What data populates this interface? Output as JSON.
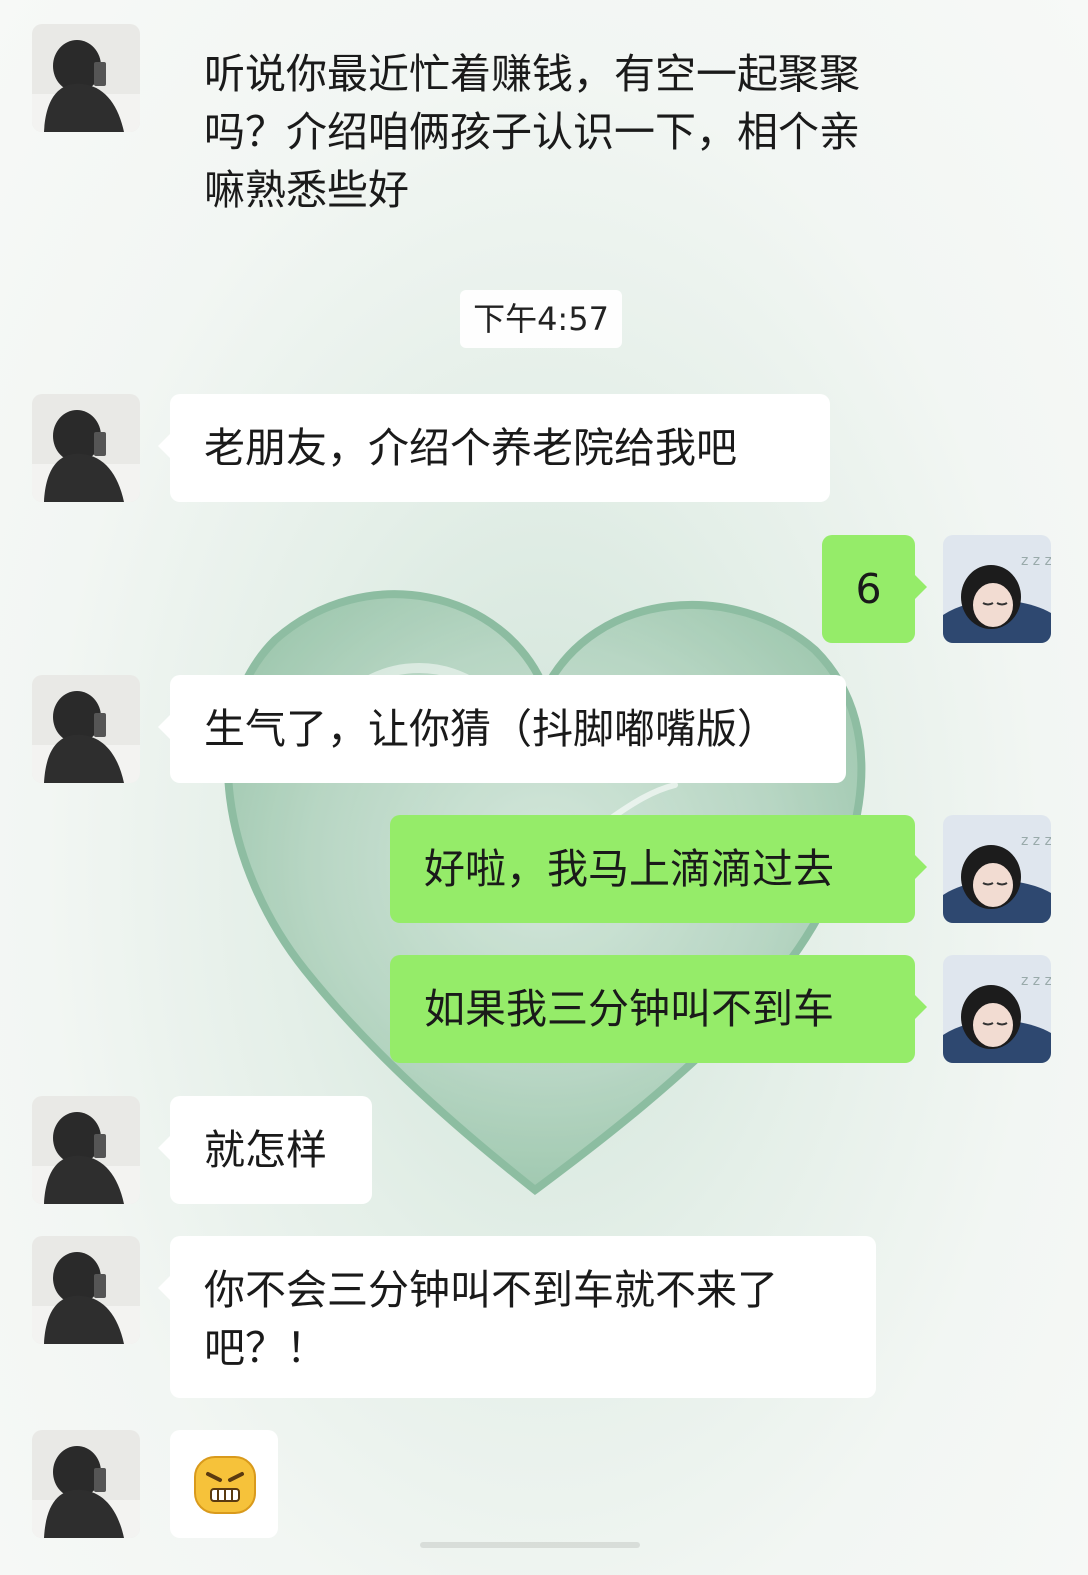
{
  "timestamp": "下午4:57",
  "messages": [
    {
      "side": "in",
      "text": "听说你最近忙着赚钱，有空一起聚聚吗？介绍咱俩孩子认识一下，相个亲嘛熟悉些好"
    },
    {
      "side": "in",
      "text": "老朋友，介绍个养老院给我吧"
    },
    {
      "side": "out",
      "text": "6"
    },
    {
      "side": "in",
      "text": "生气了，让你猜（抖脚嘟嘴版）"
    },
    {
      "side": "out",
      "text": "好啦，我马上滴滴过去"
    },
    {
      "side": "out",
      "text": "如果我三分钟叫不到车"
    },
    {
      "side": "in",
      "text": "就怎样"
    },
    {
      "side": "in",
      "text": "你不会三分钟叫不到车就不来了吧？！"
    },
    {
      "side": "in",
      "emoji": "angry-face-emoji"
    }
  ],
  "icons": {
    "contact_avatar": "hooded-person-avatar",
    "self_avatar": "sleeping-girl-avatar",
    "background": "glass-heart-wallpaper"
  },
  "colors": {
    "outgoing_bubble": "#95ec69",
    "incoming_bubble": "#ffffff",
    "wallpaper": "#dfece4"
  }
}
